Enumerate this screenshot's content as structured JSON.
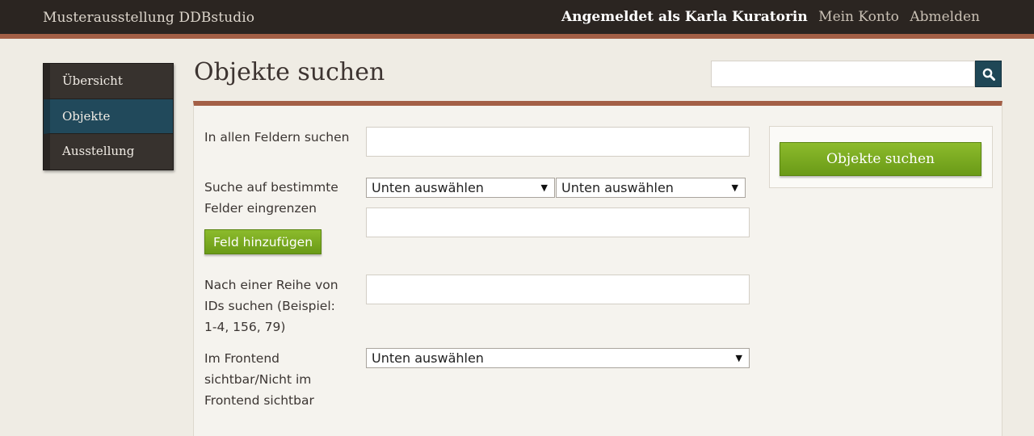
{
  "header": {
    "site_title": "Musterausstellung DDBstudio",
    "logged_in": "Angemeldet als Karla Kuratorin",
    "account_link": "Mein Konto",
    "logout_link": "Abmelden"
  },
  "sidebar": {
    "items": [
      {
        "label": "Übersicht"
      },
      {
        "label": "Objekte"
      },
      {
        "label": "Ausstellung"
      }
    ]
  },
  "page": {
    "title": "Objekte suchen",
    "search_value": ""
  },
  "form": {
    "all_fields_label": "In allen Feldern suchen",
    "all_fields_value": "",
    "restrict_label": "Suche auf bestimmte Felder eingrenzen",
    "select_field": "Unten auswählen",
    "select_operator": "Unten auswählen",
    "restrict_value": "",
    "add_field_button": "Feld hinzufügen",
    "ids_label": "Nach einer Reihe von IDs suchen (Beispiel: 1-4, 156, 79)",
    "ids_value": "",
    "frontend_label": "Im Frontend sichtbar/Nicht im Frontend sichtbar",
    "frontend_select": "Unten auswählen",
    "submit_button": "Objekte suchen"
  },
  "icons": {
    "search": "search-icon",
    "dropdown": "chevron-down-icon"
  },
  "colors": {
    "topbar": "#2b2521",
    "accent": "#a35f46",
    "active_nav": "#21495b",
    "button_green": "#7aaa20"
  }
}
